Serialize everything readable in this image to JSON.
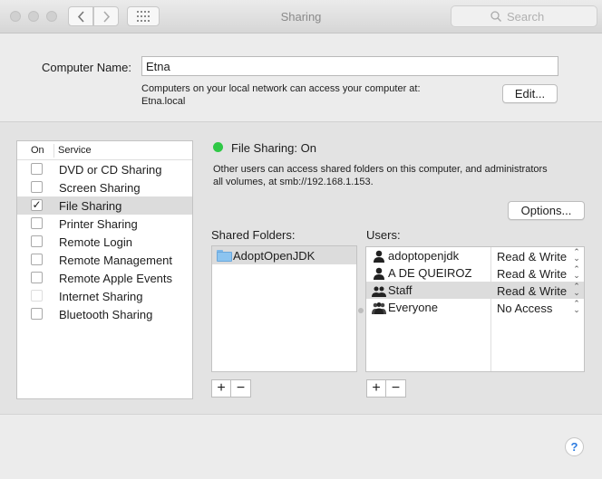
{
  "window": {
    "title": "Sharing",
    "search_placeholder": "Search"
  },
  "computer_name": {
    "label": "Computer Name:",
    "value": "Etna",
    "info_line1": "Computers on your local network can access your computer at:",
    "info_line2": "Etna.local",
    "edit_label": "Edit..."
  },
  "services": {
    "col_on": "On",
    "col_service": "Service",
    "items": [
      {
        "label": "DVD or CD Sharing",
        "checked": false
      },
      {
        "label": "Screen Sharing",
        "checked": false
      },
      {
        "label": "File Sharing",
        "checked": true
      },
      {
        "label": "Printer Sharing",
        "checked": false
      },
      {
        "label": "Remote Login",
        "checked": false
      },
      {
        "label": "Remote Management",
        "checked": false
      },
      {
        "label": "Remote Apple Events",
        "checked": false
      },
      {
        "label": "Internet Sharing",
        "checked": false
      },
      {
        "label": "Bluetooth Sharing",
        "checked": false
      }
    ]
  },
  "status": {
    "text": "File Sharing: On",
    "color": "#2fc846",
    "desc_line1": "Other users can access shared folders on this computer, and administrators",
    "desc_line2": "all volumes, at smb://192.168.1.153.",
    "options_label": "Options..."
  },
  "shared_folders": {
    "label": "Shared Folders:",
    "items": [
      "AdoptOpenJDK"
    ]
  },
  "users": {
    "label": "Users:",
    "items": [
      {
        "name": "adoptopenjdk",
        "privilege": "Read & Write"
      },
      {
        "name": "A DE QUEIROZ",
        "privilege": "Read & Write"
      },
      {
        "name": "Staff",
        "privilege": "Read & Write"
      },
      {
        "name": "Everyone",
        "privilege": "No Access"
      }
    ]
  },
  "controls": {
    "plus": "+",
    "minus": "−",
    "help": "?",
    "checkmark": "✓",
    "updown": "⌃⌄"
  }
}
